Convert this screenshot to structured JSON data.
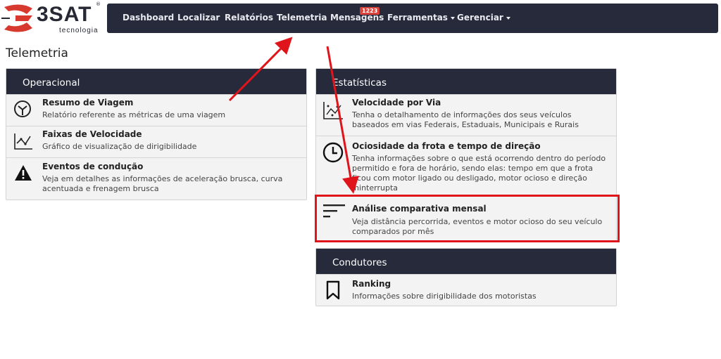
{
  "logo": {
    "brand": "3SAT",
    "sub": "tecnologia",
    "reg": "®"
  },
  "nav": {
    "items": [
      {
        "label": "Dashboard"
      },
      {
        "label": "Localizar"
      },
      {
        "label": "Relatórios"
      },
      {
        "label": "Telemetria"
      },
      {
        "label": "Mensagens"
      },
      {
        "label": "Ferramentas"
      },
      {
        "label": "Gerenciar"
      }
    ],
    "messages_badge": "1223"
  },
  "page": {
    "title": "Telemetria"
  },
  "operacional": {
    "title": "Operacional",
    "items": [
      {
        "title": "Resumo de Viagem",
        "desc": "Relatório referente as métricas de uma viagem",
        "icon": "gauge-icon"
      },
      {
        "title": "Faixas de Velocidade",
        "desc": "Gráfico de visualização de dirigibilidade",
        "icon": "line-chart-icon"
      },
      {
        "title": "Eventos de condução",
        "desc": "Veja em detalhes as informações de aceleração brusca, curva acentuada e frenagem brusca",
        "icon": "warning-icon"
      }
    ]
  },
  "estatisticas": {
    "title": "Estatísticas",
    "items": [
      {
        "title": "Velocidade por Via",
        "desc": "Tenha o detalhamento de informações dos seus veículos baseados em vias Federais, Estaduais, Municipais e Rurais",
        "icon": "scatter-chart-icon"
      },
      {
        "title": "Ociosidade da frota e tempo de direção",
        "desc": "Tenha informações sobre o que está ocorrendo dentro do período permitido e fora de horário, sendo elas: tempo em que a frota ficou com motor ligado ou desligado, motor ocioso e direção ininterrupta",
        "icon": "clock-icon"
      },
      {
        "title": "Análise comparativa mensal",
        "desc": "Veja distância percorrida, eventos e motor ocioso do seu veículo comparados por mês",
        "icon": "sort-lines-icon"
      }
    ]
  },
  "condutores": {
    "title": "Condutores",
    "items": [
      {
        "title": "Ranking",
        "desc": "Informações sobre dirigibilidade dos motoristas",
        "icon": "bookmark-icon"
      }
    ]
  },
  "colors": {
    "nav_bg": "#262a3b",
    "badge": "#d9433b",
    "annotation": "#e0141b"
  }
}
